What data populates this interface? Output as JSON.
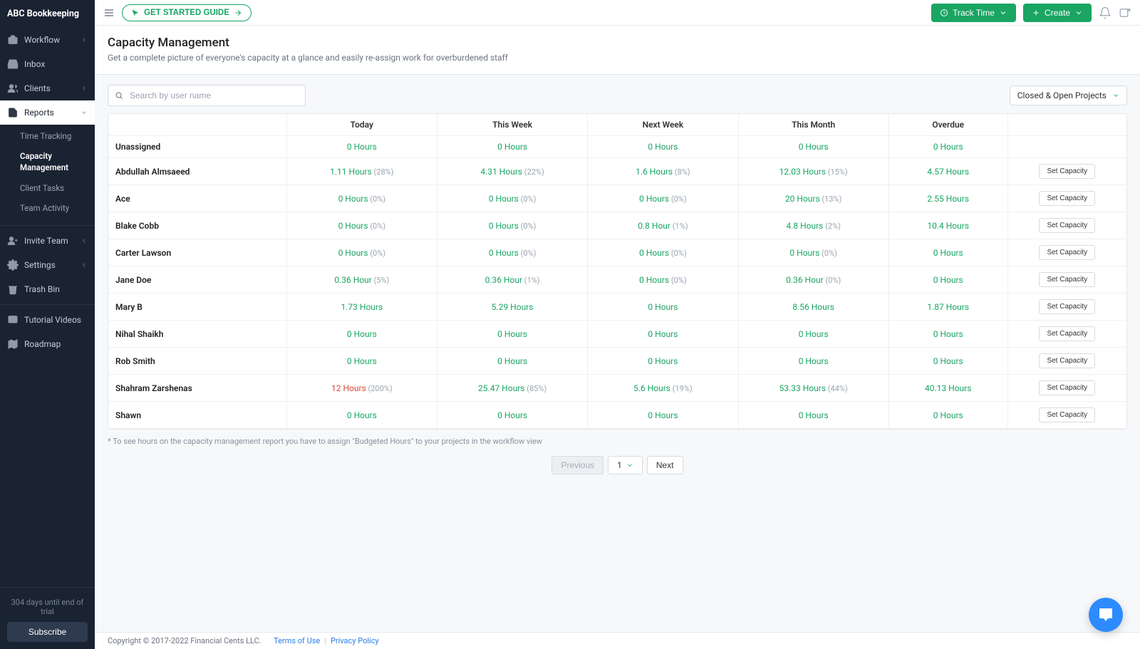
{
  "brand": "ABC Bookkeeping",
  "topbar": {
    "guide": "GET STARTED GUIDE",
    "track_time": "Track Time",
    "create": "Create"
  },
  "sidebar": {
    "items": [
      {
        "label": "Workflow",
        "icon": "briefcase",
        "chev": true
      },
      {
        "label": "Inbox",
        "icon": "inbox"
      },
      {
        "label": "Clients",
        "icon": "users",
        "chev": true
      },
      {
        "label": "Reports",
        "icon": "file",
        "chev": true,
        "expanded": true
      }
    ],
    "sub_reports": [
      {
        "label": "Time Tracking"
      },
      {
        "label": "Capacity Management",
        "active": true
      },
      {
        "label": "Client Tasks"
      },
      {
        "label": "Team Activity"
      }
    ],
    "items2": [
      {
        "label": "Invite Team",
        "icon": "user-plus",
        "chev": true
      },
      {
        "label": "Settings",
        "icon": "gear",
        "chev": true
      },
      {
        "label": "Trash Bin",
        "icon": "trash"
      }
    ],
    "items3": [
      {
        "label": "Tutorial Videos",
        "icon": "play"
      },
      {
        "label": "Roadmap",
        "icon": "map"
      }
    ],
    "trial_text": "304 days until end of trial",
    "subscribe": "Subscribe"
  },
  "page": {
    "title": "Capacity Management",
    "subtitle": "Get a complete picture of everyone's capacity at a glance and easily re-assign work for overburdened staff",
    "search_placeholder": "Search by user name",
    "filter": "Closed & Open Projects"
  },
  "table": {
    "headers": [
      "",
      "Today",
      "This Week",
      "Next Week",
      "This Month",
      "Overdue",
      ""
    ],
    "set_capacity_label": "Set Capacity",
    "rows": [
      {
        "name": "Unassigned",
        "cells": [
          {
            "val": "0 Hours"
          },
          {
            "val": "0 Hours"
          },
          {
            "val": "0 Hours"
          },
          {
            "val": "0 Hours"
          },
          {
            "val": "0 Hours"
          }
        ],
        "action": false
      },
      {
        "name": "Abdullah Almsaeed",
        "cells": [
          {
            "val": "1.11 Hours",
            "pct": "(28%)"
          },
          {
            "val": "4.31 Hours",
            "pct": "(22%)"
          },
          {
            "val": "1.6 Hours",
            "pct": "(8%)"
          },
          {
            "val": "12.03 Hours",
            "pct": "(15%)"
          },
          {
            "val": "4.57 Hours"
          }
        ],
        "action": true
      },
      {
        "name": "Ace",
        "cells": [
          {
            "val": "0 Hours",
            "pct": "(0%)"
          },
          {
            "val": "0 Hours",
            "pct": "(0%)"
          },
          {
            "val": "0 Hours",
            "pct": "(0%)"
          },
          {
            "val": "20 Hours",
            "pct": "(13%)"
          },
          {
            "val": "2.55 Hours"
          }
        ],
        "action": true
      },
      {
        "name": "Blake Cobb",
        "cells": [
          {
            "val": "0 Hours",
            "pct": "(0%)"
          },
          {
            "val": "0 Hours",
            "pct": "(0%)"
          },
          {
            "val": "0.8 Hour",
            "pct": "(1%)"
          },
          {
            "val": "4.8 Hours",
            "pct": "(2%)"
          },
          {
            "val": "10.4 Hours"
          }
        ],
        "action": true
      },
      {
        "name": "Carter Lawson",
        "cells": [
          {
            "val": "0 Hours",
            "pct": "(0%)"
          },
          {
            "val": "0 Hours",
            "pct": "(0%)"
          },
          {
            "val": "0 Hours",
            "pct": "(0%)"
          },
          {
            "val": "0 Hours",
            "pct": "(0%)"
          },
          {
            "val": "0 Hours"
          }
        ],
        "action": true
      },
      {
        "name": "Jane Doe",
        "cells": [
          {
            "val": "0.36 Hour",
            "pct": "(5%)"
          },
          {
            "val": "0.36 Hour",
            "pct": "(1%)"
          },
          {
            "val": "0 Hours",
            "pct": "(0%)"
          },
          {
            "val": "0.36 Hour",
            "pct": "(0%)"
          },
          {
            "val": "0 Hours"
          }
        ],
        "action": true
      },
      {
        "name": "Mary B",
        "cells": [
          {
            "val": "1.73 Hours"
          },
          {
            "val": "5.29 Hours"
          },
          {
            "val": "0 Hours"
          },
          {
            "val": "8.56 Hours"
          },
          {
            "val": "1.87 Hours"
          }
        ],
        "action": true
      },
      {
        "name": "Nihal Shaikh",
        "cells": [
          {
            "val": "0 Hours"
          },
          {
            "val": "0 Hours"
          },
          {
            "val": "0 Hours"
          },
          {
            "val": "0 Hours"
          },
          {
            "val": "0 Hours"
          }
        ],
        "action": true
      },
      {
        "name": "Rob Smith",
        "cells": [
          {
            "val": "0 Hours"
          },
          {
            "val": "0 Hours"
          },
          {
            "val": "0 Hours"
          },
          {
            "val": "0 Hours"
          },
          {
            "val": "0 Hours"
          }
        ],
        "action": true
      },
      {
        "name": "Shahram Zarshenas",
        "cells": [
          {
            "val": "12 Hours",
            "pct": "(200%)",
            "over": true
          },
          {
            "val": "25.47 Hours",
            "pct": "(85%)"
          },
          {
            "val": "5.6 Hours",
            "pct": "(19%)"
          },
          {
            "val": "53.33 Hours",
            "pct": "(44%)"
          },
          {
            "val": "40.13 Hours"
          }
        ],
        "action": true
      },
      {
        "name": "Shawn",
        "cells": [
          {
            "val": "0 Hours"
          },
          {
            "val": "0 Hours"
          },
          {
            "val": "0 Hours"
          },
          {
            "val": "0 Hours"
          },
          {
            "val": "0 Hours"
          }
        ],
        "action": true
      }
    ],
    "footnote": "* To see hours on the capacity management report you have to assign \"Budgeted Hours\" to your projects in the workflow view"
  },
  "pager": {
    "prev": "Previous",
    "page": "1",
    "next": "Next"
  },
  "footer": {
    "copyright": "Copyright © 2017-2022 Financial Cents LLC.",
    "terms": "Terms of Use",
    "privacy": "Privacy Policy"
  }
}
